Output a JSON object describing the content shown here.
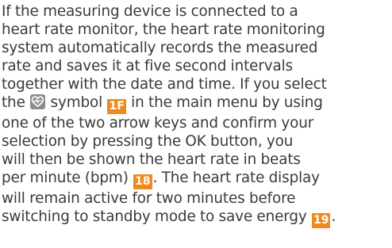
{
  "paragraph": {
    "line1": "If the measuring device is connected to a",
    "line2": "heart rate monitor, the heart rate monitoring",
    "line3": "system automatically records the measured",
    "line4": "rate and saves it at five second intervals",
    "line5": "together with the date and time. If you select",
    "line6_a": "the ",
    "line6_b": " symbol ",
    "line6_c": " in the main menu by using",
    "line7": "one of the two arrow keys and confirm your",
    "line8": "selection by pressing the OK button, you",
    "line9": "will then be shown the heart rate in beats",
    "line10_a": "per minute (bpm) ",
    "line10_b": ". The heart rate display",
    "line11": "will remain active for two minutes before",
    "line12_a": "switching to standby mode to save energy ",
    "line12_b": "."
  },
  "refs": {
    "symbol_ref": "1F",
    "bpm_ref": "18",
    "standby_ref": "19"
  },
  "icons": {
    "heart_symbol": "heart-rate-icon"
  },
  "colors": {
    "text": "#3a3a3a",
    "badge_bg": "#f08a1d",
    "badge_text": "#ffffff",
    "icon_bg": "#8c8c8c"
  }
}
